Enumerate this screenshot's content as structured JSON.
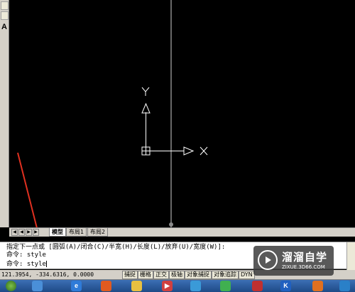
{
  "palette": {
    "text_tool_label": "A"
  },
  "canvas": {
    "ucs_x_label": "X",
    "ucs_y_label": "Y"
  },
  "layout_tabs": {
    "tabs": [
      "模型",
      "布局1",
      "布局2"
    ],
    "active": "模型"
  },
  "command": {
    "lines": [
      "指定下一点或 [圆弧(A)/闭合(C)/半宽(H)/长度(L)/放弃(U)/宽度(W)]:",
      "命令: style",
      "命令: style"
    ]
  },
  "status": {
    "coordinates": "121.3954,  -334.6316, 0.0000",
    "modes": [
      "捕捉",
      "栅格",
      "正交",
      "极轴",
      "对象捕捉",
      "对象追踪",
      "DYN"
    ]
  },
  "taskbar": {
    "icons": [
      "start-orb-icon",
      "app-icon",
      "ie-icon",
      "app-icon",
      "folder-icon",
      "media-icon",
      "app-icon",
      "app-icon",
      "app-icon",
      "app-icon",
      "app-icon",
      "app-icon"
    ]
  },
  "watermark": {
    "title": "溜溜自学",
    "url": "ZIXUE.3D66.COM"
  },
  "colors": {
    "canvas_bg": "#000000",
    "grid_line": "#808080",
    "ucs_icon": "#ffffff",
    "arrow_annotation": "#e03020"
  }
}
